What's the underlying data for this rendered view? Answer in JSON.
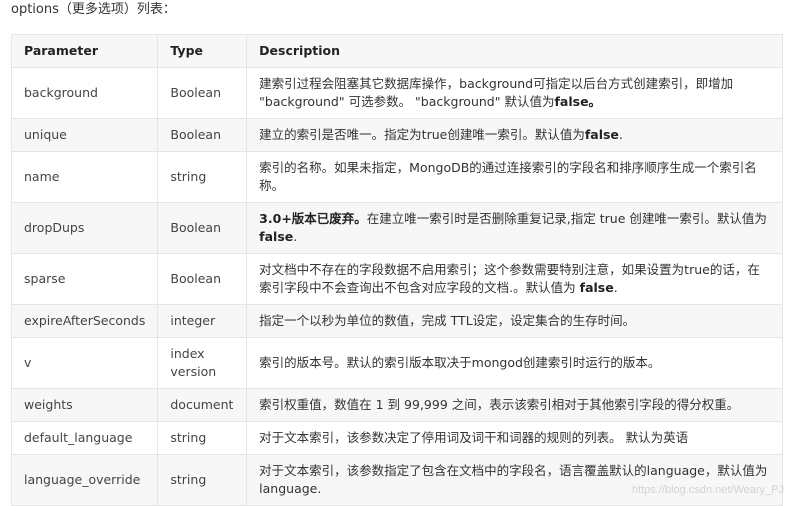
{
  "intro": "options（更多选项）列表：",
  "table": {
    "headers": [
      "Parameter",
      "Type",
      "Description"
    ],
    "rows": [
      {
        "parameter": "background",
        "type": "Boolean",
        "desc_pre": "建索引过程会阻塞其它数据库操作，background可指定以后台方式创建索引，即增加 \"background\" 可选参数。 \"background\" 默认值为",
        "desc_bold": "false。",
        "desc_post": ""
      },
      {
        "parameter": "unique",
        "type": "Boolean",
        "desc_pre": "建立的索引是否唯一。指定为true创建唯一索引。默认值为",
        "desc_bold": "false",
        "desc_post": "."
      },
      {
        "parameter": "name",
        "type": "string",
        "desc_pre": "索引的名称。如果未指定，MongoDB的通过连接索引的字段名和排序顺序生成一个索引名称。",
        "desc_bold": "",
        "desc_post": ""
      },
      {
        "parameter": "dropDups",
        "type": "Boolean",
        "desc_lead_bold": "3.0+版本已废弃。",
        "desc_pre": "在建立唯一索引时是否删除重复记录,指定 true 创建唯一索引。默认值为 ",
        "desc_bold": "false",
        "desc_post": "."
      },
      {
        "parameter": "sparse",
        "type": "Boolean",
        "desc_pre": "对文档中不存在的字段数据不启用索引；这个参数需要特别注意，如果设置为true的话，在索引字段中不会查询出不包含对应字段的文档.。默认值为 ",
        "desc_bold": "false",
        "desc_post": "."
      },
      {
        "parameter": "expireAfterSeconds",
        "type": "integer",
        "desc_pre": "指定一个以秒为单位的数值，完成 TTL设定，设定集合的生存时间。",
        "desc_bold": "",
        "desc_post": ""
      },
      {
        "parameter": "v",
        "type": "index version",
        "desc_pre": "索引的版本号。默认的索引版本取决于mongod创建索引时运行的版本。",
        "desc_bold": "",
        "desc_post": ""
      },
      {
        "parameter": "weights",
        "type": "document",
        "desc_pre": "索引权重值，数值在 1 到 99,999 之间，表示该索引相对于其他索引字段的得分权重。",
        "desc_bold": "",
        "desc_post": ""
      },
      {
        "parameter": "default_language",
        "type": "string",
        "desc_pre": "对于文本索引，该参数决定了停用词及词干和词器的规则的列表。 默认为英语",
        "desc_bold": "",
        "desc_post": ""
      },
      {
        "parameter": "language_override",
        "type": "string",
        "desc_pre": "对于文本索引，该参数指定了包含在文档中的字段名，语言覆盖默认的language，默认值为 language.",
        "desc_bold": "",
        "desc_post": ""
      }
    ]
  },
  "watermark": "https://blog.csdn.net/Weary_PJ"
}
